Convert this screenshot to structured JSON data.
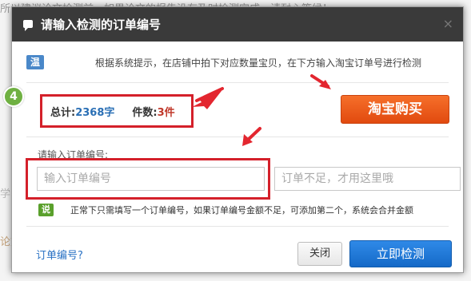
{
  "background": {
    "frag_top": "所以建议论文检测前，如果论文的报告没有及时检测完成，请耐心等候！",
    "frag_mid": "学",
    "frag_bottom": "论文"
  },
  "dialog": {
    "title": "请输入检测的订单编号",
    "close_label": "×",
    "tip_badge": "温馨提示",
    "tip_text": "根据系统提示，在店铺中拍下对应数量宝贝，在下方输入淘宝订单号进行检测",
    "step_marker": "4",
    "total_label": "总计:",
    "total_value": "2368字",
    "count_label": "件数:",
    "count_value": "3件",
    "taobao_button": "淘宝购买",
    "order_label": "请输入订单编号:",
    "order_placeholder": "输入订单编号",
    "order_placeholder2": "订单不足，才用这里哦",
    "note_badge": "说明",
    "note_text": "正常下只需填写一个订单编号，如果订单编号金额不足，可添加第二个，系统会合并金额",
    "help_link": "订单编号?",
    "close_button": "关闭",
    "detect_button": "立即检测"
  },
  "colors": {
    "highlight": "#d4202a",
    "accent_orange": "#e8561a",
    "accent_blue": "#1e78d6"
  }
}
